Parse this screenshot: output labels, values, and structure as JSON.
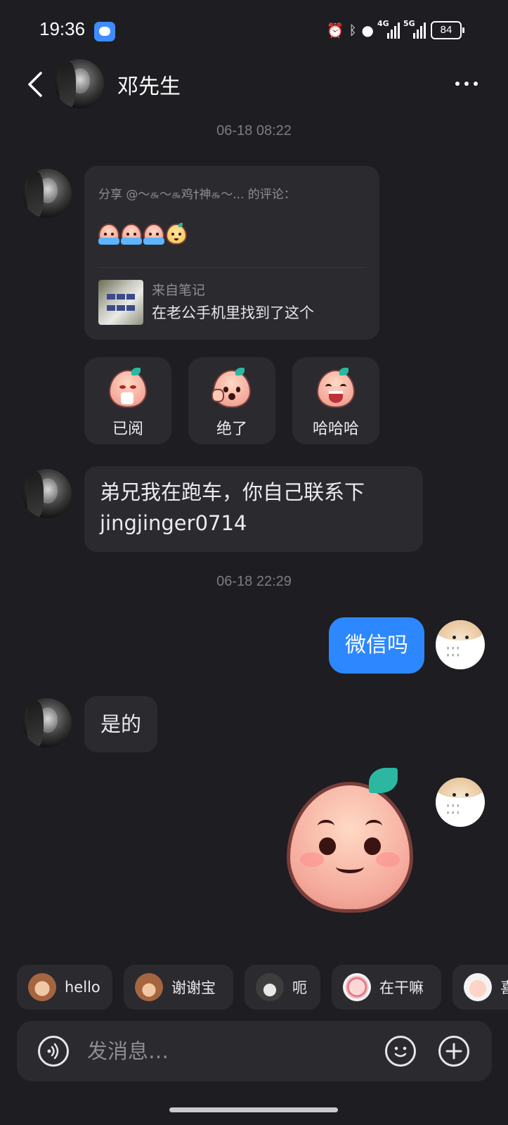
{
  "status_bar": {
    "time": "19:36",
    "signal1_label": "4G",
    "signal2_label": "5G",
    "battery": "84"
  },
  "header": {
    "title": "邓先生"
  },
  "messages": {
    "timestamp1": "06-18 08:22",
    "share_card": {
      "from_text": "分享 @〜௬〜௬鸡†神௬〜... 的评论：",
      "note_label": "来自笔记",
      "note_title": "在老公手机里找到了这个"
    },
    "reactions": [
      {
        "label": "已阅"
      },
      {
        "label": "绝了"
      },
      {
        "label": "哈哈哈"
      }
    ],
    "incoming_text_1_line1": "弟兄我在跑车，你自己联系下",
    "incoming_text_1_line2": "jingjinger0714",
    "timestamp2": "06-18 22:29",
    "outgoing_text_1": "微信吗",
    "incoming_text_2": "是的"
  },
  "quick_replies": [
    {
      "label": "hello",
      "icon": "monkey-emoji-icon"
    },
    {
      "label": "谢谢宝",
      "icon": "monkey-flower-emoji-icon"
    },
    {
      "label": "呃",
      "icon": "cat-emoji-icon"
    },
    {
      "label": "在干嘛",
      "icon": "peeking-emoji-icon"
    },
    {
      "label": "喜",
      "icon": "happy-emoji-icon"
    }
  ],
  "input": {
    "placeholder": "发消息…"
  },
  "colors": {
    "background": "#1d1d22",
    "bubble": "#2a2a2f",
    "accent_blue": "#2d87ff"
  }
}
